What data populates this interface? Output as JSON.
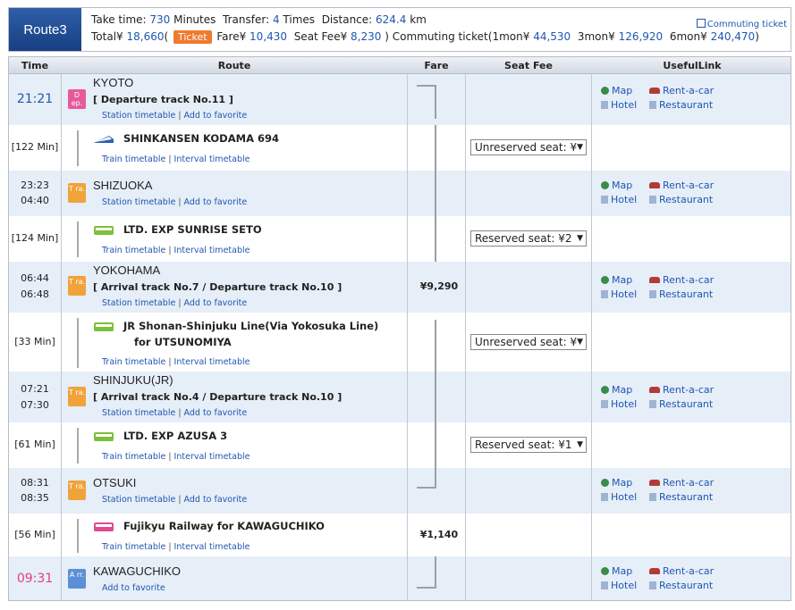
{
  "summary": {
    "route_tab": "Route3",
    "take_time_label": "Take time:",
    "take_time_value": "730",
    "take_time_unit": "Minutes",
    "transfer_label": "Transfer:",
    "transfer_value": "4",
    "transfer_unit": "Times",
    "distance_label": "Distance:",
    "distance_value": "624.4",
    "distance_unit": "km",
    "total_label": "Total¥",
    "total_value": "18,660",
    "ticket_badge": "Ticket",
    "fare_label": "Fare¥",
    "fare_value": "10,430",
    "seat_fee_label": "Seat Fee¥",
    "seat_fee_value": "8,230",
    "commuting_label": ")  Commuting ticket(1mon¥",
    "commute_1mon": "44,530",
    "commute_3mon_label": "3mon¥",
    "commute_3mon": "126,920",
    "commute_6mon_label": "6mon¥",
    "commute_6mon": "240,470",
    "commuting_link": "Commuting ticket"
  },
  "headers": {
    "time": "Time",
    "route": "Route",
    "fare": "Fare",
    "seat_fee": "Seat Fee",
    "useful_link": "UsefulLink"
  },
  "links": {
    "station_timetable": "Station timetable",
    "add_favorite": "Add to favorite",
    "train_timetable": "Train timetable",
    "interval_timetable": "Interval timetable",
    "map": "Map",
    "rent_a_car": "Rent-a-car",
    "hotel": "Hotel",
    "restaurant": "Restaurant"
  },
  "badges": {
    "dep": "D ep.",
    "tra": "T ra.",
    "arr": "A rr."
  },
  "stations": [
    {
      "time1": "21:21",
      "name": "KYOTO",
      "track": "[ Departure track No.11 ]"
    },
    {
      "time1": "23:23",
      "time2": "04:40",
      "name": "SHIZUOKA"
    },
    {
      "time1": "06:44",
      "time2": "06:48",
      "name": "YOKOHAMA",
      "track": "[ Arrival track No.7 / Departure track No.10 ]",
      "fare": "¥9,290"
    },
    {
      "time1": "07:21",
      "time2": "07:30",
      "name": "SHINJUKU(JR)",
      "track": "[ Arrival track No.4 / Departure track No.10 ]"
    },
    {
      "time1": "08:31",
      "time2": "08:35",
      "name": "OTSUKI"
    },
    {
      "time1": "09:31",
      "name": "KAWAGUCHIKO"
    }
  ],
  "legs": [
    {
      "duration": "[122 Min]",
      "train": "SHINKANSEN KODAMA 694",
      "seat": "Unreserved seat: ¥"
    },
    {
      "duration": "[124 Min]",
      "train": "LTD. EXP SUNRISE SETO",
      "seat": "Reserved seat: ¥2"
    },
    {
      "duration": "[33 Min]",
      "train": "JR Shonan-Shinjuku Line(Via Yokosuka Line)",
      "train2": "for UTSUNOMIYA",
      "seat": "Unreserved seat: ¥"
    },
    {
      "duration": "[61 Min]",
      "train": "LTD. EXP AZUSA 3",
      "seat": "Reserved seat: ¥1"
    },
    {
      "duration": "[56 Min]",
      "train": "Fujikyu Railway  for KAWAGUCHIKO",
      "fare": "¥1,140"
    }
  ]
}
